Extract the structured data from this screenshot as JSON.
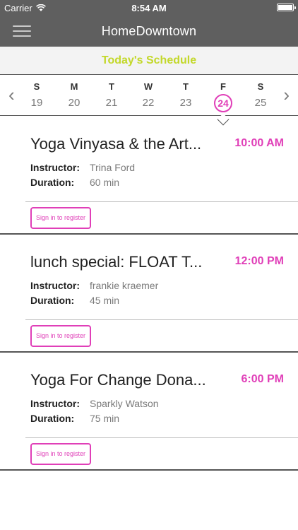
{
  "status_bar": {
    "carrier": "Carrier",
    "time": "8:54 AM",
    "wifi_icon": "wifi-icon",
    "battery_icon": "battery-icon"
  },
  "nav": {
    "title": "HomeDowntown",
    "menu_icon": "hamburger-menu-icon"
  },
  "schedule_header": "Today's Schedule",
  "week": {
    "prev_icon": "chevron-left-icon",
    "next_icon": "chevron-right-icon",
    "selected_index": 5,
    "days": [
      {
        "letter": "S",
        "num": "19"
      },
      {
        "letter": "M",
        "num": "20"
      },
      {
        "letter": "T",
        "num": "21"
      },
      {
        "letter": "W",
        "num": "22"
      },
      {
        "letter": "T",
        "num": "23"
      },
      {
        "letter": "F",
        "num": "24"
      },
      {
        "letter": "S",
        "num": "25"
      }
    ]
  },
  "classes": [
    {
      "title": "Yoga Vinyasa & the Art...",
      "time": "10:00 AM",
      "instructor_label": "Instructor:",
      "instructor": "Trina Ford",
      "duration_label": "Duration:",
      "duration": "60 min",
      "button": "Sign in to register"
    },
    {
      "title": "lunch special: FLOAT T...",
      "time": "12:00 PM",
      "instructor_label": "Instructor:",
      "instructor": "frankie kraemer",
      "duration_label": "Duration:",
      "duration": "45 min",
      "button": "Sign in to register"
    },
    {
      "title": "Yoga For Change Dona...",
      "time": "6:00 PM",
      "instructor_label": "Instructor:",
      "instructor": "Sparkly Watson",
      "duration_label": "Duration:",
      "duration": "75 min",
      "button": "Sign in to register"
    }
  ],
  "colors": {
    "accent": "#e03fb8",
    "header_text": "#c3d82a",
    "nav_bg": "#5f5f5f"
  }
}
